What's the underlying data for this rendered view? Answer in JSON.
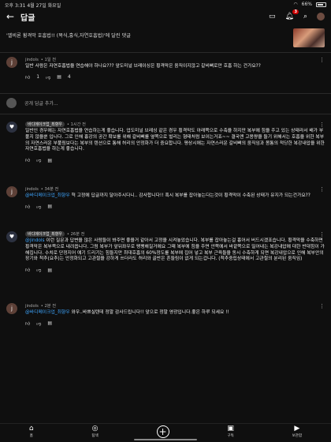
{
  "status": {
    "time": "오후 3:31",
    "date": "4월 27일 화요일",
    "battery": "66%"
  },
  "header": {
    "back_icon": "arrow-left-icon",
    "title": "답글",
    "notification_count": "3"
  },
  "context": {
    "text": "'엘비론 횡격막 호흡법!! (복식,흉식,자연호흡법)'에 달린 댓글"
  },
  "parent_comment": {
    "author": "jindols",
    "time": "• 1일 전",
    "text": "일반 사람은 자연호흡법을 연습해야 하나요??? 앞도미널 브레이싱은 횡격막은 움직이지않고 갈비뼈로만 호흡 하는 건가요??",
    "likes": "1",
    "replies": "4"
  },
  "reply_input": {
    "placeholder": "공개 답글 추가..."
  },
  "replies": [
    {
      "author": "바디메이크업_최향우",
      "time": "• 1시간 전",
      "text": "일반인 경우에는 자연호흡법을 연습하는게 좋습니다. 업도미널 브레싱 같은 경우 횡격막도 아래쪽으로 수축을 하지만 복부에 힘을 주고 있는 상태라서 배가 부풀지 않을뿐 입니다. 그로 인해 흉강의 공간 확보를 위해 갈비뼈를 옆쪽으로 벌리는 형태처럼 보이는거죠~~ 결국엔 고용량을 들기 위해서는 호흡을 위한 복부의 자연스러운 부풀림보다는 복부의 텐션으로 통해 허리의 안정화가 더 중요합니다. 평상시에는 자연스러운 갈비뼈의 움직임과 몸통의 적당한 복강내압을 위한 자연호흡법을 하는게 좋습니다."
    },
    {
      "author": "jindols",
      "time": "• 34분 전",
      "mention": "@바디메이크업_최향우",
      "text": " 헉 고정에 답글까지 달아주시다니.. 감사합니다!! 혹시 복부를 잡아놓는다는것이 횡격막이 수축된 상태가 유지가 되는건가요??"
    },
    {
      "author": "바디메이크업_최향우",
      "time": "• 26분 전",
      "mention": "@jindols",
      "text": " 이런 질문과 답변을 많은 사람들이 봐주면 좋을거 같아서 고정을 시켜놓았습니다. 복부를 잡아놓는걸 흉어서 버드시겠죠습니다. 횡격막을 수축하면 횡격막은 복부쪽으로 내려옵니다. 그럼 복부가 앞뒤좌우로 팽팽해질거에요 그때 복부에 힘을 주면 안쪽에서 바깥쪽으로 밀어내는 복강내압에 대한 반대힘이 가해집니다. 수치로 단정지어 얘기 드리기는 힘들지만 최대호흡의 60%정도를 복부에 집어 넣고 복부 근육들을 동시 수축하게 되면 복강내압으로 인해 복부안의 장기와 척추(요추)는 안정화되고 고관절을 강하게 쓰더라도 허리와 골반은 흔들림이 없게 되는겁니다. (척추중립상태에서 고관절의 분리된 움직임)"
    },
    {
      "author": "jindols",
      "time": "• 2분 전",
      "mention": "@바디메이크업_최향우",
      "text": " 와우..바쁘실텐데 정말 감사드립니다!! 앞으로 정말 영광입니다.좋은 하루 되세요 !!"
    }
  ],
  "navbar": {
    "items": [
      {
        "label": "홈",
        "icon": "home-icon"
      },
      {
        "label": "탐색",
        "icon": "explore-icon"
      },
      {
        "label": "",
        "icon": "create-plus-icon"
      },
      {
        "label": "구독",
        "icon": "subscriptions-icon"
      },
      {
        "label": "보관함",
        "icon": "library-icon"
      }
    ]
  }
}
